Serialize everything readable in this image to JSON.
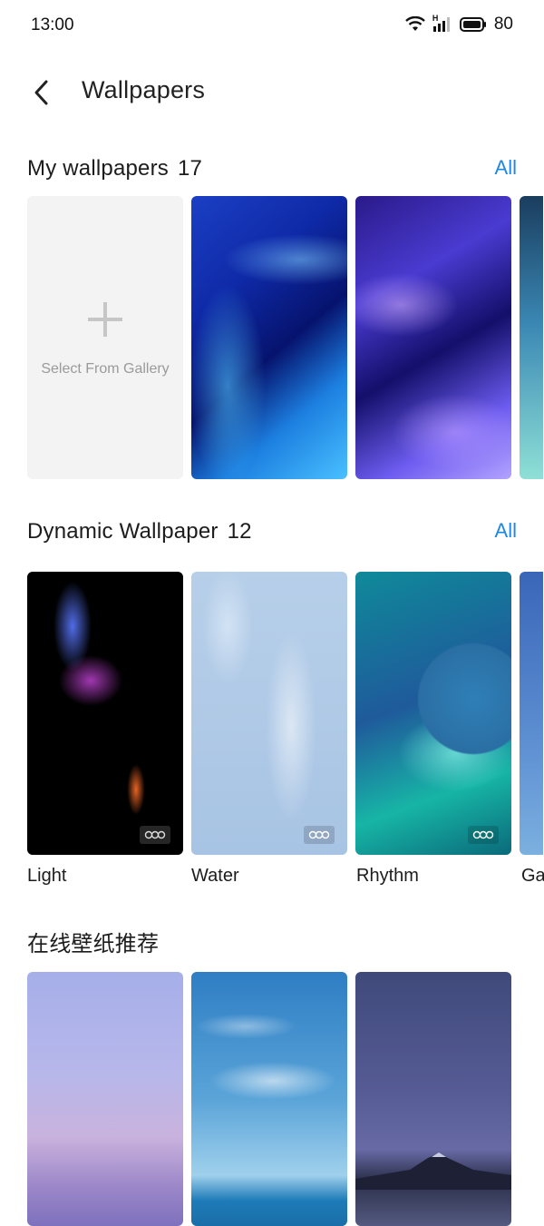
{
  "status": {
    "time": "13:00",
    "battery": "80",
    "network_label": "H"
  },
  "header": {
    "title": "Wallpapers"
  },
  "my_wallpapers": {
    "title": "My wallpapers",
    "count": "17",
    "all_label": "All",
    "gallery_label": "Select From Gallery"
  },
  "dynamic": {
    "title": "Dynamic Wallpaper",
    "count": "12",
    "all_label": "All",
    "items": [
      {
        "caption": "Light"
      },
      {
        "caption": "Water"
      },
      {
        "caption": "Rhythm"
      },
      {
        "caption": "Ga"
      }
    ]
  },
  "online": {
    "title": "在线壁纸推荐"
  }
}
